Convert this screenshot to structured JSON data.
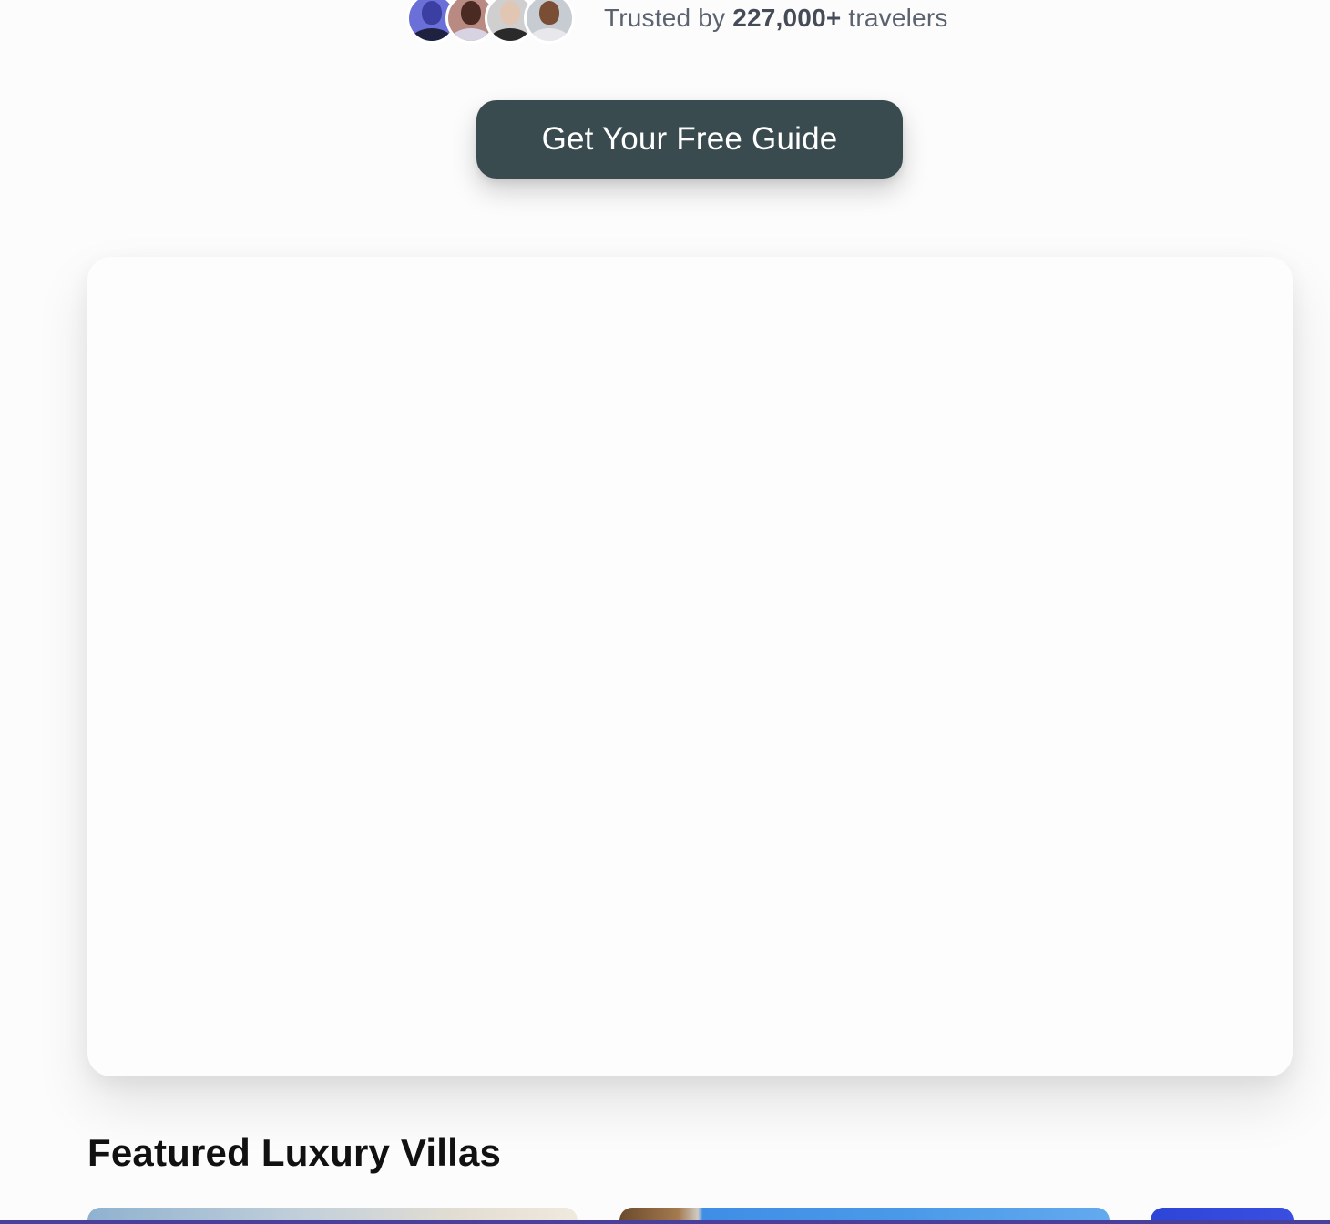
{
  "trusted": {
    "prefix": "Trusted by",
    "count": "227,000+",
    "suffix": "travelers",
    "avatars": [
      {
        "name": "avatar-1",
        "bg": "#6b6fd8",
        "skin": "#3b3fa2",
        "shirt": "#1e2140"
      },
      {
        "name": "avatar-2",
        "bg": "#b98a82",
        "skin": "#4a2a22",
        "shirt": "#d7d3e3"
      },
      {
        "name": "avatar-3",
        "bg": "#cfcfcf",
        "skin": "#e2c6b4",
        "shirt": "#2a2a2a"
      },
      {
        "name": "avatar-4",
        "bg": "#c7ccd3",
        "skin": "#7a4d35",
        "shirt": "#e8e8ec"
      }
    ]
  },
  "cta": {
    "label": "Get Your Free Guide",
    "color": "#394b4e"
  },
  "featured": {
    "title": "Featured Luxury Villas"
  }
}
